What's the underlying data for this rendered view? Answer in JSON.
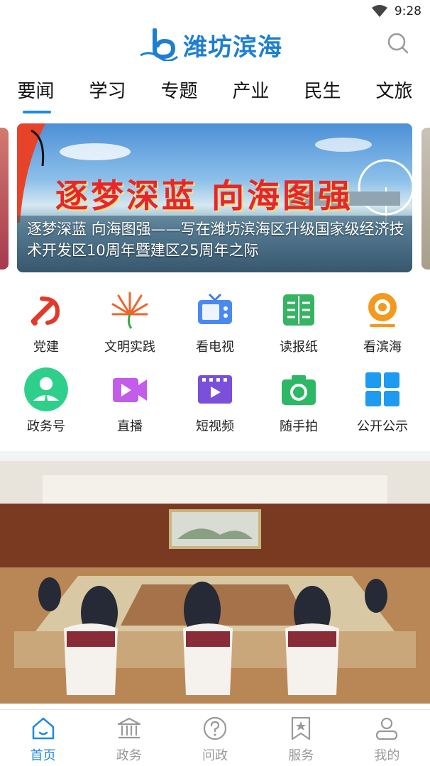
{
  "status_bar": {
    "time": "9:28"
  },
  "header": {
    "app_name": "潍坊滨海"
  },
  "tabs": [
    {
      "label": "要闻",
      "active": true
    },
    {
      "label": "学习"
    },
    {
      "label": "专题"
    },
    {
      "label": "产业"
    },
    {
      "label": "民生"
    },
    {
      "label": "文旅"
    }
  ],
  "banner": {
    "headline": "逐梦深蓝 向海图强",
    "caption": "逐梦深蓝 向海图强——写在潍坊滨海区升级国家级经济技术开发区10周年暨建区25周年之际"
  },
  "grid": [
    {
      "label": "党建",
      "icon": "party-emblem-icon"
    },
    {
      "label": "文明实践",
      "icon": "civilization-flower-icon"
    },
    {
      "label": "看电视",
      "icon": "tv-icon"
    },
    {
      "label": "读报纸",
      "icon": "newspaper-icon"
    },
    {
      "label": "看滨海",
      "icon": "camera-lens-icon"
    },
    {
      "label": "政务号",
      "icon": "government-account-icon"
    },
    {
      "label": "直播",
      "icon": "live-video-icon"
    },
    {
      "label": "短视频",
      "icon": "short-video-icon"
    },
    {
      "label": "随手拍",
      "icon": "snapshot-camera-icon"
    },
    {
      "label": "公开公示",
      "icon": "public-notice-icon"
    }
  ],
  "bottom_nav": [
    {
      "label": "首页",
      "icon": "home-icon",
      "active": true
    },
    {
      "label": "政务",
      "icon": "government-icon"
    },
    {
      "label": "问政",
      "icon": "question-icon"
    },
    {
      "label": "服务",
      "icon": "service-bookmark-icon"
    },
    {
      "label": "我的",
      "icon": "user-icon"
    }
  ],
  "colors": {
    "accent": "#1d8ae3",
    "logo": "#1f7fcf",
    "inactive": "#999999"
  }
}
